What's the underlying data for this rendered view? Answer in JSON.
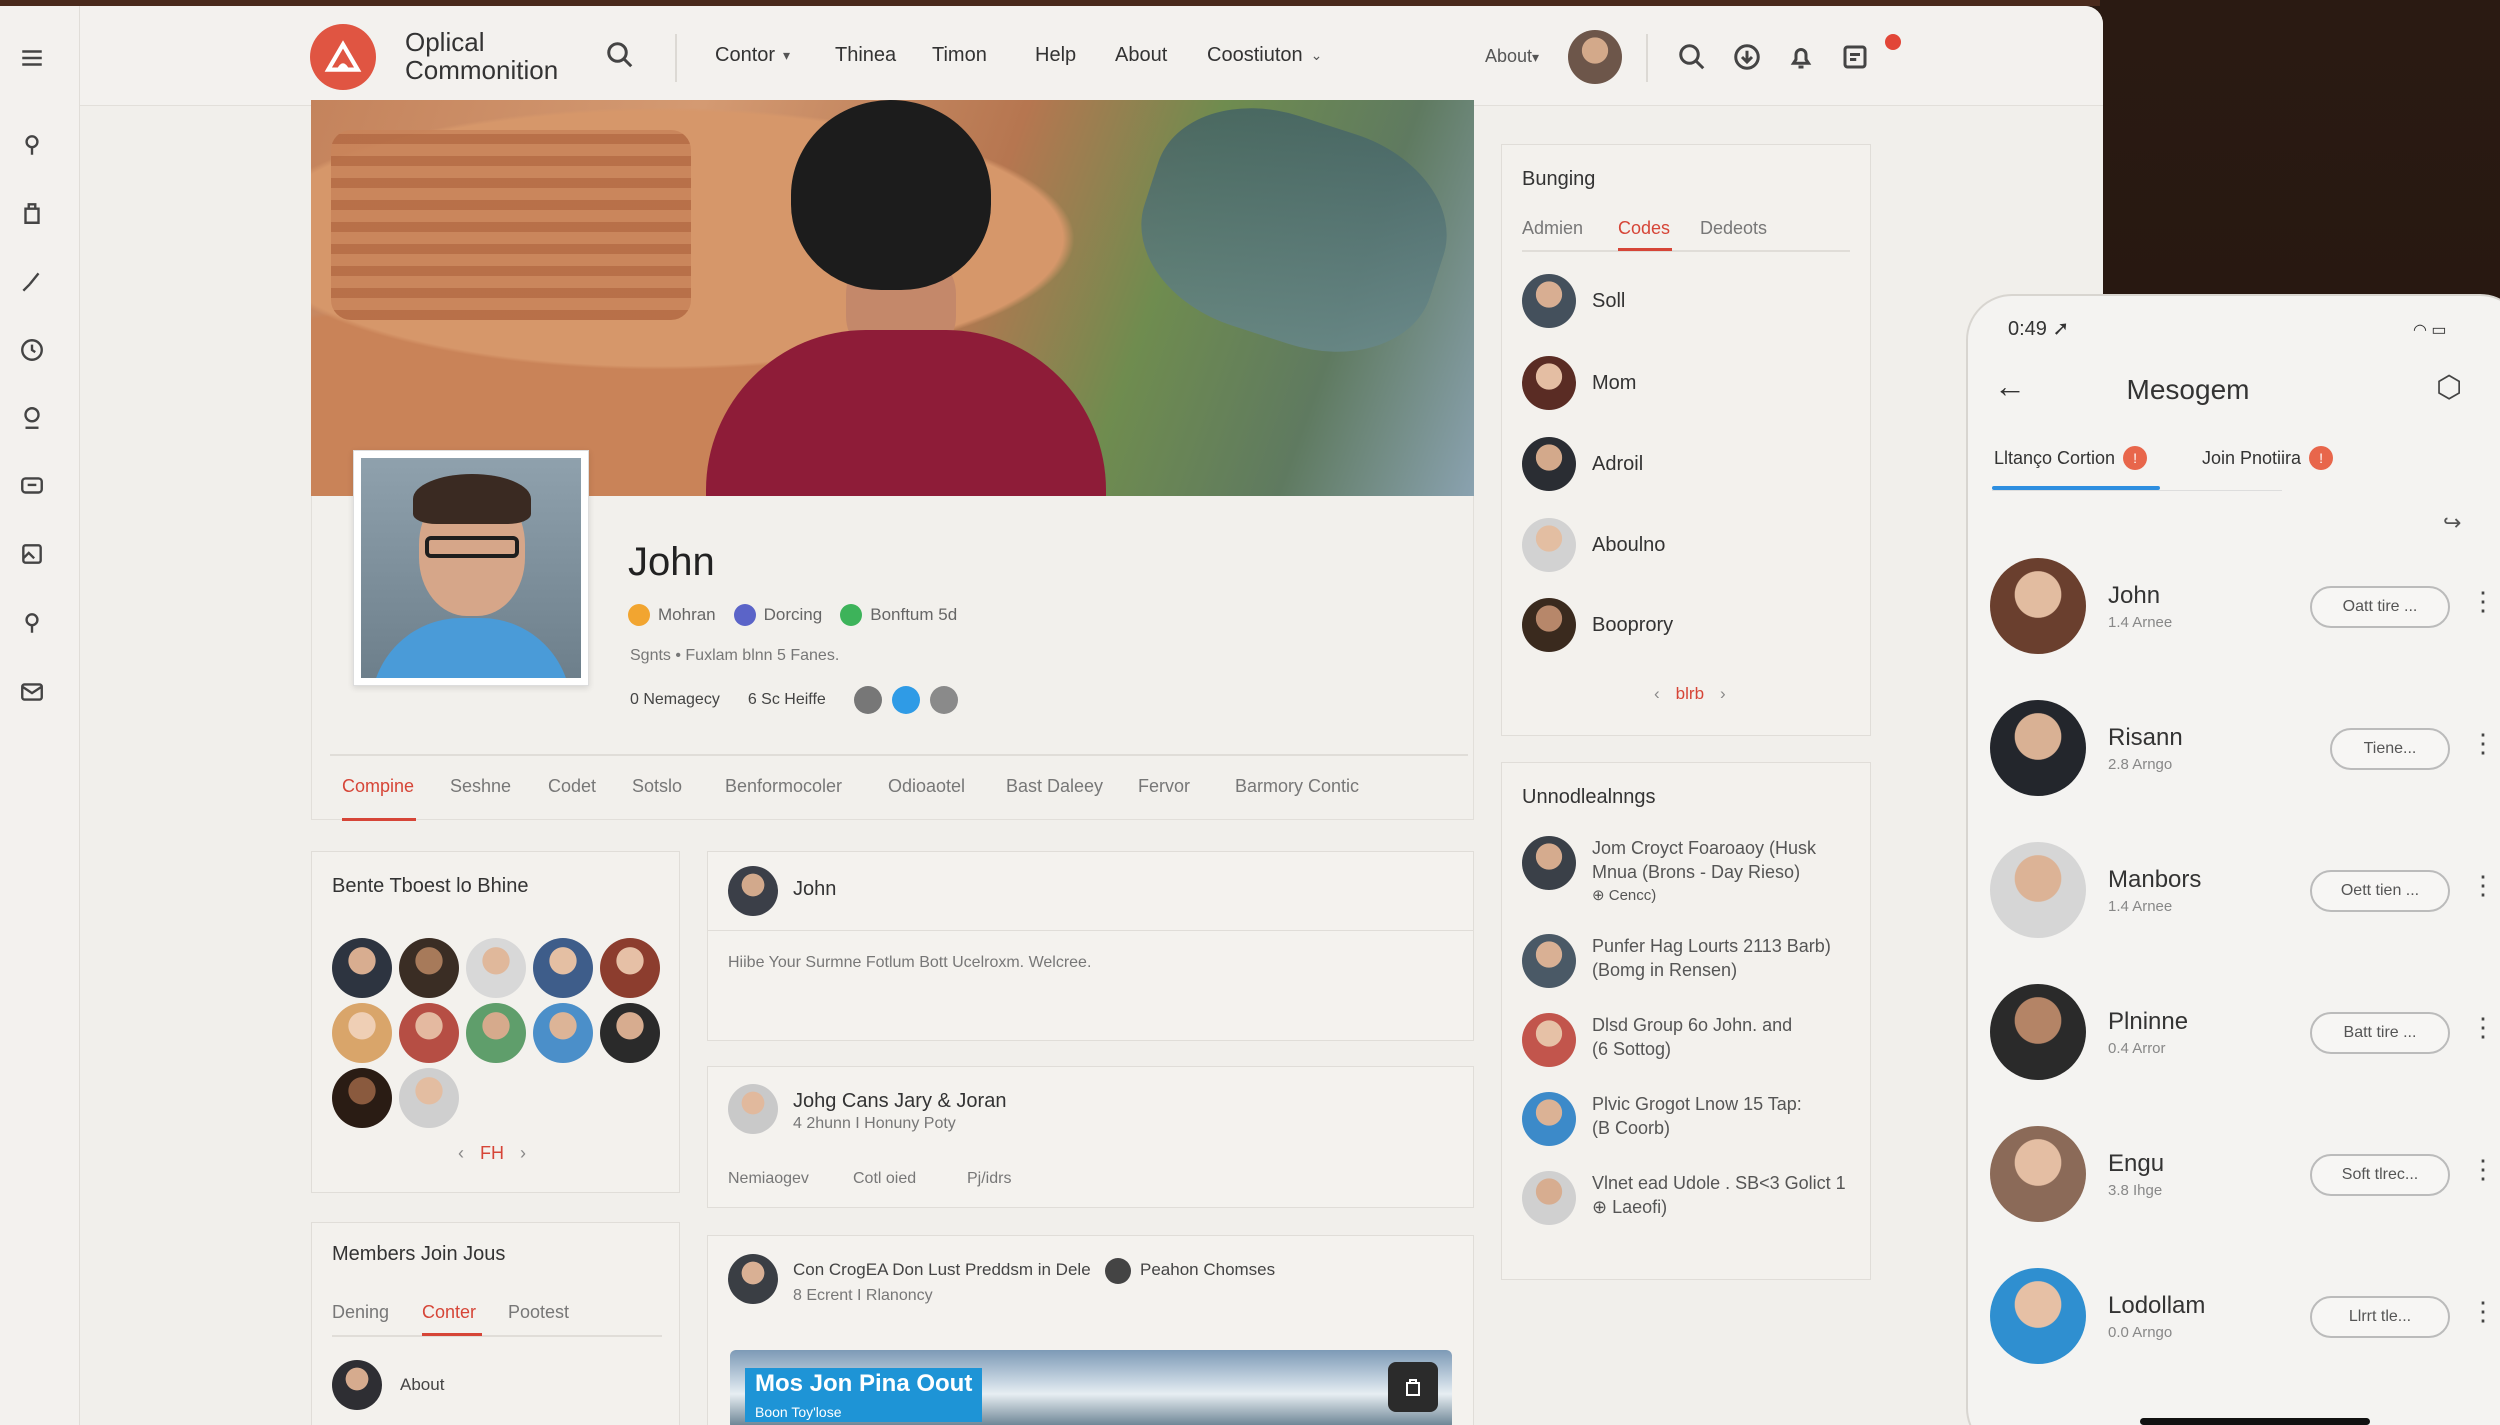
{
  "app": {
    "brand_line1": "Oplical",
    "brand_line2": "Commonition"
  },
  "nav": {
    "items": [
      "Contor",
      "Thinea",
      "Timon",
      "Help",
      "About",
      "Coostiuton"
    ],
    "about_short": "About"
  },
  "profile": {
    "name": "John",
    "badges": [
      {
        "label": "Mohran",
        "color": "#f2a530"
      },
      {
        "label": "Dorcing",
        "color": "#5b64c8"
      },
      {
        "label": "Bonftum 5d",
        "color": "#3db35a"
      }
    ],
    "subtitle": "Sgnts • Fuxlam blnn 5 Fanes.",
    "stat1": "0 Nemagecy",
    "stat2": "6 Sc Heiffe"
  },
  "profile_tabs": [
    "Compine",
    "Seshne",
    "Codet",
    "Sotslo",
    "Benformocoler",
    "Odioaotel",
    "Bast Daleey",
    "Fervor",
    "Barmory Contic"
  ],
  "left_panel_1": {
    "title": "Bente Tboest lo Bhine",
    "pager_current": "FH",
    "pager_prev": "‹",
    "pager_next": "›"
  },
  "left_panel_2": {
    "title": "Members Join Jous",
    "tabs": [
      "Dening",
      "Conter",
      "Pootest"
    ],
    "item": "About"
  },
  "feed": {
    "post1_name": "John",
    "post1_text": "Hiibe Your Surmne Fotlum Bott Ucelroxm. Welcree.",
    "post2_name": "Johg Cans Jary & Joran",
    "post2_sub": "4 2hunn I Honuny Poty",
    "post2_actions": [
      "Nemiaogev",
      "Cotl oied",
      "Pj/idrs"
    ],
    "post3_name": "Con CrogEA Don Lust Preddsm in Dele",
    "post3_tag": "Peahon Chomses",
    "post3_sub": "8 Ecrent I Rlanoncy",
    "banner_title": "Mos Jon Pina Oout",
    "banner_sub": "Boon Toy'lose"
  },
  "right_panel_1": {
    "title": "Bunging",
    "tabs": [
      "Admien",
      "Codes",
      "Dedeots"
    ],
    "people": [
      "Soll",
      "Mom",
      "Adroil",
      "Aboulno",
      "Booprory"
    ],
    "pager_current": "blrb",
    "pager_prev": "‹",
    "pager_next": "›"
  },
  "right_panel_2": {
    "title": "Unnodlealnngs",
    "items": [
      {
        "line1": "Jom Croyct Foaroaoy (Husk",
        "line2": "Mnua (Brons - Day Rieso)",
        "line3": "⊕ Cencc)"
      },
      {
        "line1": "Punfer Hag Lourts 2113 Barb)",
        "line2": "(Bomg in Rensen)",
        "line3": ""
      },
      {
        "line1": "Dlsd Group 6o John. and",
        "line2": "(6 Sottog)",
        "line3": ""
      },
      {
        "line1": "Plvic Grogot Lnow 15 Tap:",
        "line2": "(B Coorb)",
        "line3": ""
      },
      {
        "line1": "Vlnet ead Udole . SB<3 Golict 1",
        "line2": "⊕ Laeofi)",
        "line3": ""
      }
    ]
  },
  "phone": {
    "time": "0:49",
    "title": "Mesogem",
    "tabs": [
      {
        "label": "Lltanço Cortion",
        "badge": "!"
      },
      {
        "label": "Join Pnotiira",
        "badge": "!"
      }
    ],
    "messages": [
      {
        "name": "John",
        "sub": "1.4 Arnee",
        "button": "Oatt tire ..."
      },
      {
        "name": "Risann",
        "sub": "2.8 Arngo",
        "button": "Tiene..."
      },
      {
        "name": "Manbors",
        "sub": "1.4 Arnee",
        "button": "Oett tien ..."
      },
      {
        "name": "Plninne",
        "sub": "0.4 Arror",
        "button": "Batt tire ..."
      },
      {
        "name": "Engu",
        "sub": "3.8 Ihge",
        "button": "Soft tlrec..."
      },
      {
        "name": "Lodollam",
        "sub": "0.0 Arngo",
        "button": "Llrrt tle..."
      }
    ]
  },
  "colors": {
    "accent": "#d64537",
    "phone_tab": "#2d8ee0"
  }
}
